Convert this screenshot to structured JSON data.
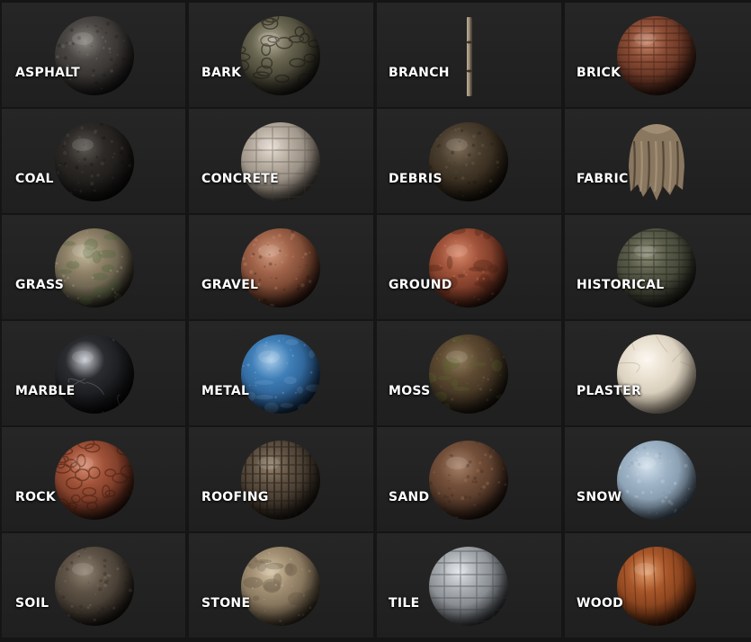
{
  "materials": [
    {
      "label": "ASPHALT",
      "icon": "asphalt-sphere-icon",
      "shape": "sphere",
      "base": "#4a4744",
      "mid": "#2f2c2a",
      "dark": "#111010",
      "hi": "#8a8580",
      "spot": "#1c1a19",
      "pattern": "speckle"
    },
    {
      "label": "BARK",
      "icon": "bark-sphere-icon",
      "shape": "sphere",
      "base": "#6a6752",
      "mid": "#3c3a2c",
      "dark": "#121110",
      "hi": "#b5b09a",
      "spot": "#1e1c15",
      "pattern": "cells"
    },
    {
      "label": "BRANCH",
      "icon": "branch-stick-icon",
      "shape": "stick",
      "base": "#8f826e",
      "mid": "#5e5343",
      "dark": "#2a2219",
      "hi": "#c9bba3",
      "spot": "#3b3127",
      "pattern": "none"
    },
    {
      "label": "BRICK",
      "icon": "brick-sphere-icon",
      "shape": "sphere",
      "base": "#8a4c35",
      "mid": "#5a2e1f",
      "dark": "#1e0f0a",
      "hi": "#c8876a",
      "spot": "#3e1f14",
      "pattern": "bricks"
    },
    {
      "label": "COAL",
      "icon": "coal-sphere-icon",
      "shape": "sphere",
      "base": "#2d2a27",
      "mid": "#1c1a18",
      "dark": "#080807",
      "hi": "#5c5853",
      "spot": "#0f0e0d",
      "pattern": "speckle"
    },
    {
      "label": "CONCRETE",
      "icon": "concrete-sphere-icon",
      "shape": "sphere",
      "base": "#b6aca0",
      "mid": "#8a8176",
      "dark": "#3e3933",
      "hi": "#e6ddd2",
      "spot": "#6d655c",
      "pattern": "blocks"
    },
    {
      "label": "DEBRIS",
      "icon": "debris-sphere-icon",
      "shape": "sphere",
      "base": "#4b3f30",
      "mid": "#302619",
      "dark": "#0e0b07",
      "hi": "#7c6b55",
      "spot": "#1d160d",
      "pattern": "speckle"
    },
    {
      "label": "FABRIC",
      "icon": "fabric-cloth-icon",
      "shape": "cloth",
      "base": "#8a7760",
      "mid": "#5e4f3d",
      "dark": "#2b221a",
      "hi": "#b8a488",
      "spot": "#3f3327",
      "pattern": "none"
    },
    {
      "label": "GRASS",
      "icon": "grass-sphere-icon",
      "shape": "sphere",
      "base": "#8e8168",
      "mid": "#5f5745",
      "dark": "#1e1b15",
      "hi": "#c4b89c",
      "spot": "#4f6a3a",
      "pattern": "patches"
    },
    {
      "label": "GRAVEL",
      "icon": "gravel-sphere-icon",
      "shape": "sphere",
      "base": "#a1644a",
      "mid": "#6b3d2a",
      "dark": "#1f110b",
      "hi": "#d09a80",
      "spot": "#2a1710",
      "pattern": "speckle"
    },
    {
      "label": "GROUND",
      "icon": "ground-sphere-icon",
      "shape": "sphere",
      "base": "#a0533a",
      "mid": "#6e3322",
      "dark": "#22100a",
      "hi": "#d98a6c",
      "spot": "#4a2114",
      "pattern": "patches"
    },
    {
      "label": "HISTORICAL",
      "icon": "historical-sphere-icon",
      "shape": "sphere",
      "base": "#5a5c4a",
      "mid": "#3b3d30",
      "dark": "#121310",
      "hi": "#8f917a",
      "spot": "#222319",
      "pattern": "bricks"
    },
    {
      "label": "MARBLE",
      "icon": "marble-sphere-icon",
      "shape": "sphere",
      "base": "#2b2c30",
      "mid": "#17181b",
      "dark": "#050506",
      "hi": "#c9ccd4",
      "spot": "#6f7178",
      "pattern": "veins"
    },
    {
      "label": "METAL",
      "icon": "metal-sphere-icon",
      "shape": "sphere",
      "base": "#3f7fb8",
      "mid": "#28598a",
      "dark": "#0e2238",
      "hi": "#a9cdea",
      "spot": "#6c9ccb",
      "pattern": "patches"
    },
    {
      "label": "MOSS",
      "icon": "moss-sphere-icon",
      "shape": "sphere",
      "base": "#5e4a32",
      "mid": "#3c2f1f",
      "dark": "#120e09",
      "hi": "#8f7c5a",
      "spot": "#56642c",
      "pattern": "patches"
    },
    {
      "label": "PLASTER",
      "icon": "plaster-sphere-icon",
      "shape": "sphere",
      "base": "#e9e0d0",
      "mid": "#cfc4b1",
      "dark": "#8f8574",
      "hi": "#fbf7ef",
      "spot": "#b9ad9a",
      "pattern": "veins"
    },
    {
      "label": "ROCK",
      "icon": "rock-sphere-icon",
      "shape": "sphere",
      "base": "#a05238",
      "mid": "#6d3321",
      "dark": "#200f09",
      "hi": "#d88c70",
      "spot": "#4a2013",
      "pattern": "cells"
    },
    {
      "label": "ROOFING",
      "icon": "roofing-sphere-icon",
      "shape": "sphere",
      "base": "#5f5142",
      "mid": "#3c3228",
      "dark": "#120f0b",
      "hi": "#94826c",
      "spot": "#221c15",
      "pattern": "grid"
    },
    {
      "label": "SAND",
      "icon": "sand-sphere-icon",
      "shape": "sphere",
      "base": "#74503a",
      "mid": "#4e3425",
      "dark": "#180f0a",
      "hi": "#a8826a",
      "spot": "#3a2519",
      "pattern": "speckle"
    },
    {
      "label": "SNOW",
      "icon": "snow-sphere-icon",
      "shape": "sphere",
      "base": "#9fb4c7",
      "mid": "#7e93a6",
      "dark": "#3a4856",
      "hi": "#d3e1ed",
      "spot": "#8497a9",
      "pattern": "speckle"
    },
    {
      "label": "SOIL",
      "icon": "soil-sphere-icon",
      "shape": "sphere",
      "base": "#5e5346",
      "mid": "#3e362d",
      "dark": "#120f0c",
      "hi": "#8f8372",
      "spot": "#2a241d",
      "pattern": "speckle"
    },
    {
      "label": "STONE",
      "icon": "stone-sphere-icon",
      "shape": "sphere",
      "base": "#a28f73",
      "mid": "#76664f",
      "dark": "#2a2419",
      "hi": "#d4c3a4",
      "spot": "#5d503e",
      "pattern": "patches"
    },
    {
      "label": "TILE",
      "icon": "tile-sphere-icon",
      "shape": "sphere",
      "base": "#a7acb1",
      "mid": "#75797e",
      "dark": "#2b2d30",
      "hi": "#e1e5e8",
      "spot": "#4f5357",
      "pattern": "blocks"
    },
    {
      "label": "WOOD",
      "icon": "wood-sphere-icon",
      "shape": "sphere",
      "base": "#a9572a",
      "mid": "#7a3b19",
      "dark": "#2b1307",
      "hi": "#e3a070",
      "spot": "#5f2d12",
      "pattern": "planks"
    }
  ]
}
